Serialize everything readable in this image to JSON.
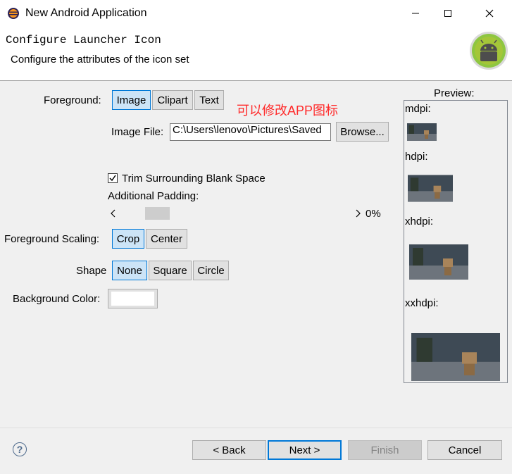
{
  "window": {
    "title": "New Android Application",
    "controls": [
      "minimize",
      "maximize",
      "close"
    ]
  },
  "header": {
    "title": "Configure Launcher Icon",
    "description": "Configure the attributes of the icon set"
  },
  "foreground": {
    "label": "Foreground:",
    "options": [
      "Image",
      "Clipart",
      "Text"
    ],
    "selected": "Image"
  },
  "annotation": "可以修改APP图标",
  "image_file": {
    "label": "Image File:",
    "value": "C:\\Users\\lenovo\\Pictures\\Saved",
    "browse_label": "Browse..."
  },
  "trim": {
    "label": "Trim Surrounding Blank Space",
    "checked": true
  },
  "padding": {
    "label": "Additional Padding:",
    "value_text": "0%",
    "value": 0
  },
  "scaling": {
    "label": "Foreground Scaling:",
    "options": [
      "Crop",
      "Center"
    ],
    "selected": "Crop"
  },
  "shape": {
    "label": "Shape",
    "options": [
      "None",
      "Square",
      "Circle"
    ],
    "selected": "None"
  },
  "background_color": {
    "label": "Background Color:",
    "value": "#ffffff"
  },
  "preview": {
    "label": "Preview:",
    "densities": [
      "mdpi:",
      "hdpi:",
      "xhdpi:",
      "xxhdpi:"
    ]
  },
  "footer": {
    "back": "< Back",
    "next": "Next >",
    "finish": "Finish",
    "cancel": "Cancel"
  },
  "colors": {
    "selected_button": "#cce4f7",
    "accent": "#0078d7",
    "annotation": "#ff2a2a"
  }
}
